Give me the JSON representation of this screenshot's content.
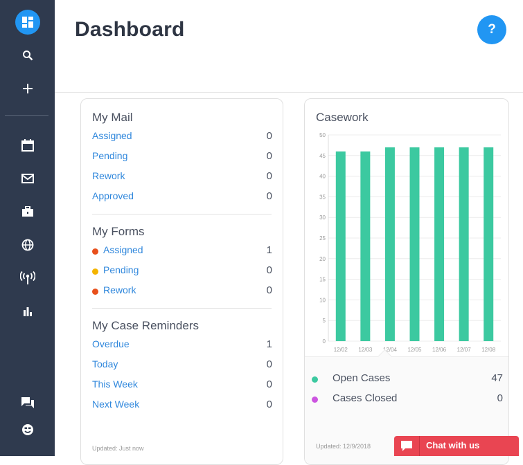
{
  "header": {
    "title": "Dashboard",
    "help_label": "?"
  },
  "sidebar": {
    "items": [
      {
        "name": "dashboard-icon"
      },
      {
        "name": "search-icon"
      },
      {
        "name": "add-icon"
      },
      {
        "name": "calendar-icon"
      },
      {
        "name": "mail-icon"
      },
      {
        "name": "briefcase-icon"
      },
      {
        "name": "globe-icon"
      },
      {
        "name": "broadcast-icon"
      },
      {
        "name": "bar-chart-icon"
      },
      {
        "name": "chat-icon"
      },
      {
        "name": "smiley-icon"
      }
    ]
  },
  "my_mail": {
    "title": "My Mail",
    "rows": [
      {
        "label": "Assigned",
        "count": "0"
      },
      {
        "label": "Pending",
        "count": "0"
      },
      {
        "label": "Rework",
        "count": "0"
      },
      {
        "label": "Approved",
        "count": "0"
      }
    ]
  },
  "my_forms": {
    "title": "My Forms",
    "rows": [
      {
        "label": "Assigned",
        "count": "1",
        "dot_color": "#e8501c"
      },
      {
        "label": "Pending",
        "count": "0",
        "dot_color": "#f4b400"
      },
      {
        "label": "Rework",
        "count": "0",
        "dot_color": "#e8501c"
      }
    ]
  },
  "my_case_reminders": {
    "title": "My Case Reminders",
    "rows": [
      {
        "label": "Overdue",
        "count": "1"
      },
      {
        "label": "Today",
        "count": "0"
      },
      {
        "label": "This Week",
        "count": "0"
      },
      {
        "label": "Next Week",
        "count": "0"
      }
    ]
  },
  "mail_updated": "Updated: Just now",
  "casework": {
    "title": "Casework",
    "updated": "Updated: 12/9/2018",
    "legend": [
      {
        "label": "Open Cases",
        "count": "47",
        "color": "#3cc9a0"
      },
      {
        "label": "Cases Closed",
        "count": "0",
        "color": "#cc55e0"
      }
    ]
  },
  "chart_data": {
    "type": "bar",
    "title": "Casework",
    "categories": [
      "12/02",
      "12/03",
      "12/04",
      "12/05",
      "12/06",
      "12/07",
      "12/08"
    ],
    "series": [
      {
        "name": "Open Cases",
        "values": [
          46,
          46,
          47,
          47,
          47,
          47,
          47
        ],
        "color": "#3cc9a0"
      }
    ],
    "ylim": [
      0,
      50
    ],
    "yticks": [
      0,
      5,
      10,
      15,
      20,
      25,
      30,
      35,
      40,
      45,
      50
    ],
    "grid": true
  },
  "chat": {
    "label": "Chat with us"
  }
}
